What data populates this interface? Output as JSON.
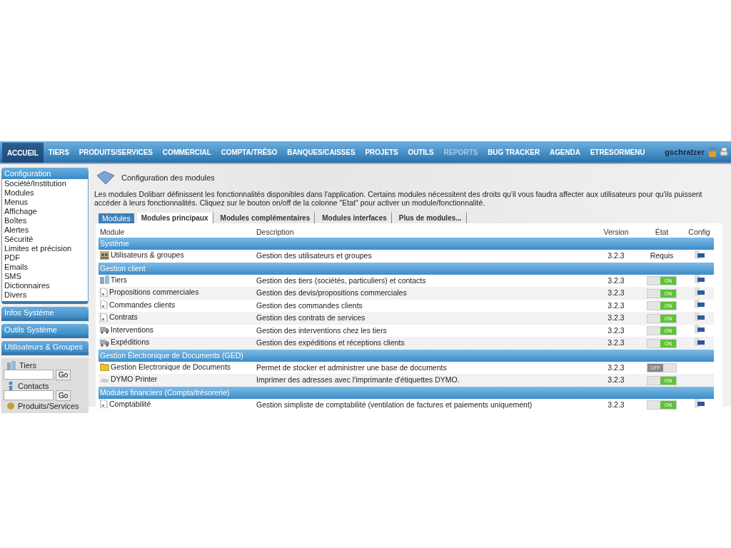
{
  "nav": {
    "items": [
      {
        "label": "ACCUEIL",
        "selected": true,
        "disabled": false
      },
      {
        "label": "TIERS",
        "selected": false,
        "disabled": false
      },
      {
        "label": "PRODUITS/SERVICES",
        "selected": false,
        "disabled": false
      },
      {
        "label": "COMMERCIAL",
        "selected": false,
        "disabled": false
      },
      {
        "label": "COMPTA/TRÉSO",
        "selected": false,
        "disabled": false
      },
      {
        "label": "BANQUES/CAISSES",
        "selected": false,
        "disabled": false
      },
      {
        "label": "PROJETS",
        "selected": false,
        "disabled": false
      },
      {
        "label": "OUTILS",
        "selected": false,
        "disabled": false
      },
      {
        "label": "REPORTS",
        "selected": false,
        "disabled": true
      },
      {
        "label": "BUG TRACKER",
        "selected": false,
        "disabled": false
      },
      {
        "label": "AGENDA",
        "selected": false,
        "disabled": false
      },
      {
        "label": "ETRESORMENU",
        "selected": false,
        "disabled": false
      }
    ],
    "user": "gschratzer"
  },
  "sidebar": {
    "menus": [
      {
        "title": "Configuration",
        "selected": true,
        "items": [
          "Société/Institution",
          "Modules",
          "Menus",
          "Affichage",
          "Boîtes",
          "Alertes",
          "Sécurité",
          "Limites et précision",
          "PDF",
          "Emails",
          "SMS",
          "Dictionnaires",
          "Divers"
        ]
      },
      {
        "title": "Infos Système",
        "selected": false
      },
      {
        "title": "Outils Système",
        "selected": false
      },
      {
        "title": "Utilisateurs & Groupes",
        "selected": false
      }
    ],
    "searches": [
      {
        "label": "Tiers",
        "button": "Go"
      },
      {
        "label": "Contacts",
        "button": "Go"
      },
      {
        "label": "Produits/Services"
      }
    ]
  },
  "page": {
    "title": "Configuration des modules",
    "intro": "Les modules Dolibarr définissent les fonctionnalités disponibles dans l'application. Certains modules nécessitent des droits qu'il vous faudra affecter aux utilisateurs pour qu'ils puissent accéder à leurs fonctionnalités. Cliquez sur le bouton on/off de la colonne \"Etat\" pour activer un module/fonctionnalité."
  },
  "tabs": {
    "label": "Modules",
    "items": [
      {
        "label": "Modules principaux",
        "selected": true
      },
      {
        "label": "Modules complémentaires",
        "selected": false
      },
      {
        "label": "Modules interfaces",
        "selected": false
      },
      {
        "label": "Plus de modules...",
        "selected": false
      }
    ]
  },
  "table": {
    "columns": [
      "Module",
      "Description",
      "Version",
      "État",
      "Config"
    ],
    "rows": [
      {
        "kind": "group",
        "label": "Système"
      },
      {
        "kind": "module",
        "name": "Utilisateurs & groupes",
        "description": "Gestion des utilisateurs et groupes",
        "version": "3.2.3",
        "state_text": "Requis",
        "config": true
      },
      {
        "kind": "group",
        "label": "Gestion client"
      },
      {
        "kind": "module",
        "name": "Tiers",
        "description": "Gestion des tiers (sociétés, particuliers) et contacts",
        "version": "3.2.3",
        "on": true,
        "toggle_text": "ON",
        "config": true
      },
      {
        "kind": "module",
        "name": "Propositions commerciales",
        "description": "Gestion des devis/propositions commerciales",
        "version": "3.2.3",
        "on": true,
        "toggle_text": "ON",
        "config": true
      },
      {
        "kind": "module",
        "name": "Commandes clients",
        "description": "Gestion des commandes clients",
        "version": "3.2.3",
        "on": true,
        "toggle_text": "ON",
        "config": true
      },
      {
        "kind": "module",
        "name": "Contrats",
        "description": "Gestion des contrats de services",
        "version": "3.2.3",
        "on": true,
        "toggle_text": "ON",
        "config": true
      },
      {
        "kind": "module",
        "name": "Interventions",
        "description": "Gestion des interventions chez les tiers",
        "version": "3.2.3",
        "on": true,
        "toggle_text": "ON",
        "config": true
      },
      {
        "kind": "module",
        "name": "Expéditions",
        "description": "Gestion des expéditions et réceptions clients",
        "version": "3.2.3",
        "on": true,
        "toggle_text": "ON",
        "config": true
      },
      {
        "kind": "group",
        "label": "Gestion Électronique de Documents (GED)"
      },
      {
        "kind": "module",
        "name": "Gestion Electronique de Documents",
        "description": "Permet de stocker et administrer une base de documents",
        "version": "3.2.3",
        "on": false,
        "toggle_text": "OFF",
        "config": false
      },
      {
        "kind": "module",
        "name": "DYMO Printer",
        "description": "Imprimer des adresses avec l'imprimante d'étiquettes DYMO.",
        "version": "3.2.3",
        "on": true,
        "toggle_text": "ON",
        "config": false
      },
      {
        "kind": "group",
        "label": "Modules financiers (Compta/trésorerie)"
      },
      {
        "kind": "module",
        "name": "Comptabilité",
        "description": "Gestion simpliste de comptabilité (ventilation de factures et paiements uniquement)",
        "version": "3.2.3",
        "on": true,
        "toggle_text": "ON",
        "config": true
      }
    ]
  }
}
